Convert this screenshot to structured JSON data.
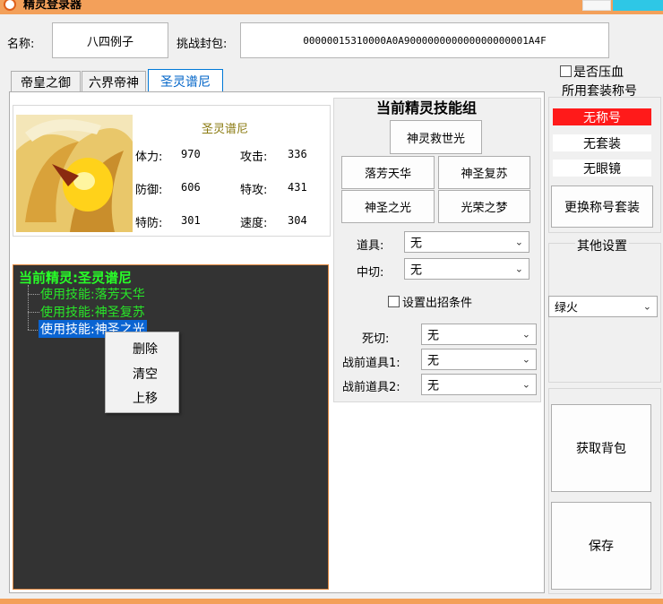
{
  "window": {
    "title": "精灵登录器"
  },
  "top": {
    "name_label": "名称:",
    "name_value": "八四例子",
    "packet_label": "挑战封包:",
    "packet_value": "00000015310000A0A900000000000000000001A4F"
  },
  "tabs": [
    {
      "label": "帝皇之御"
    },
    {
      "label": "六界帝神"
    },
    {
      "label": "圣灵谱尼",
      "active": true
    }
  ],
  "pet": {
    "name": "圣灵谱尼",
    "stats": [
      {
        "label": "体力:",
        "value": "970"
      },
      {
        "label": "攻击:",
        "value": "336"
      },
      {
        "label": "防御:",
        "value": "606"
      },
      {
        "label": "特攻:",
        "value": "431"
      },
      {
        "label": "特防:",
        "value": "301"
      },
      {
        "label": "速度:",
        "value": "304"
      }
    ]
  },
  "tree": {
    "root": "当前精灵:圣灵谱尼",
    "items": [
      "使用技能:落芳天华",
      "使用技能:神圣复苏",
      "使用技能:神圣之光"
    ],
    "selected_index": 2
  },
  "context_menu": {
    "items": [
      "删除",
      "清空",
      "上移"
    ]
  },
  "skills": {
    "title": "当前精灵技能组",
    "buttons": [
      "神灵救世光",
      "落芳天华",
      "神圣复苏",
      "神圣之光",
      "光荣之梦"
    ],
    "item_label": "道具:",
    "item_value": "无",
    "switch_label": "中切:",
    "switch_value": "无",
    "condition_label": "设置出招条件",
    "death_switch_label": "死切:",
    "death_switch_value": "无",
    "pre_item1_label": "战前道具1:",
    "pre_item1_value": "无",
    "pre_item2_label": "战前道具2:",
    "pre_item2_value": "无"
  },
  "right": {
    "pressure_label": "是否压血",
    "suit_title": "所用套装称号",
    "title_value": "无称号",
    "suit_value": "无套装",
    "glasses_value": "无眼镜",
    "change_button": "更换称号套装",
    "other_settings": "其他设置",
    "fire_value": "绿火",
    "backpack_button": "获取背包",
    "save_button": "保存"
  },
  "colors": {
    "title_bar": "#f3a05a",
    "tree_bg": "#333333",
    "tree_text": "#28ff28",
    "tree_selected": "#0a64d2",
    "badge_red": "#ff1a1a",
    "tab_active_text": "#0064c8"
  }
}
